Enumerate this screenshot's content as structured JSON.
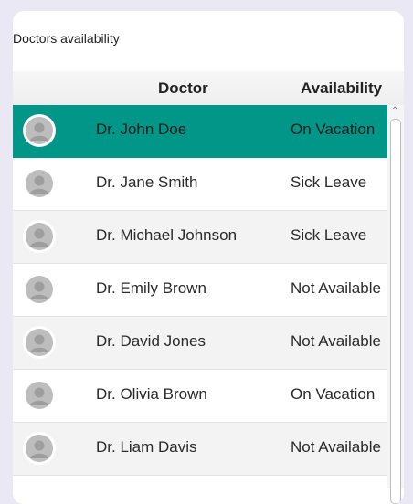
{
  "panel": {
    "title": "Doctors availability"
  },
  "table": {
    "columns": {
      "doctor": "Doctor",
      "availability": "Availability"
    },
    "rows": [
      {
        "doctor": "Dr. John Doe",
        "availability": "On Vacation",
        "selected": true
      },
      {
        "doctor": "Dr. Jane Smith",
        "availability": "Sick Leave",
        "selected": false
      },
      {
        "doctor": "Dr. Michael Johnson",
        "availability": "Sick Leave",
        "selected": false
      },
      {
        "doctor": "Dr. Emily Brown",
        "availability": "Not Available",
        "selected": false
      },
      {
        "doctor": "Dr. David Jones",
        "availability": "Not Available",
        "selected": false
      },
      {
        "doctor": "Dr. Olivia Brown",
        "availability": "On Vacation",
        "selected": false
      },
      {
        "doctor": "Dr. Liam Davis",
        "availability": "Not Available",
        "selected": false
      }
    ]
  },
  "icons": {
    "avatar": "avatar-icon",
    "scroll_up": "chevron-up-icon"
  },
  "colors": {
    "selected_row": "#009688",
    "background": "#e9e8f4"
  }
}
